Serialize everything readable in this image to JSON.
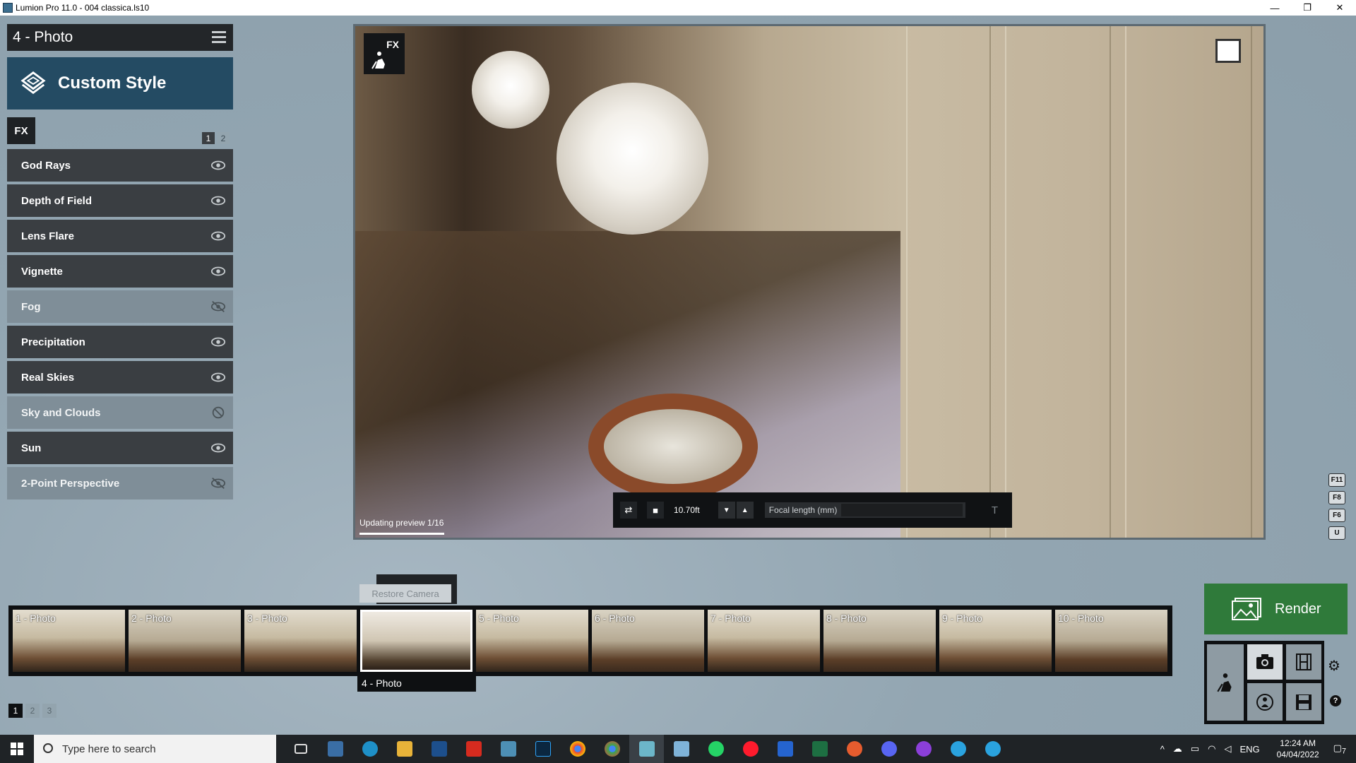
{
  "window": {
    "title": "Lumion Pro 11.0  - 004 classica.ls10",
    "controls": [
      "—",
      "❐",
      "✕"
    ]
  },
  "left_panel": {
    "photo_title": "4 - Photo",
    "style_name": "Custom Style",
    "fx_tab": "FX",
    "fx_pages": [
      "1",
      "2"
    ],
    "effects": [
      {
        "label": "God Rays",
        "visible": true
      },
      {
        "label": "Depth of Field",
        "visible": true
      },
      {
        "label": "Lens Flare",
        "visible": true
      },
      {
        "label": "Vignette",
        "visible": true
      },
      {
        "label": "Fog",
        "visible": false
      },
      {
        "label": "Precipitation",
        "visible": true
      },
      {
        "label": "Real Skies",
        "visible": true
      },
      {
        "label": "Sky and Clouds",
        "visible": false
      },
      {
        "label": "Sun",
        "visible": true
      },
      {
        "label": "2-Point Perspective",
        "visible": false
      }
    ]
  },
  "viewport": {
    "fx_badge": "FX",
    "status": "Updating preview 1/16",
    "camera_height": "10.70ft",
    "focal_label": "Focal length (mm)",
    "t_icon": "T"
  },
  "side_keys": [
    "F11",
    "F8",
    "F6",
    "U"
  ],
  "restore_camera": "Restore Camera",
  "photos": [
    "1 - Photo",
    "2 - Photo",
    "3 - Photo",
    "",
    "5 - Photo",
    "6 - Photo",
    "7 - Photo",
    "8 - Photo",
    "9 - Photo",
    "10 - Photo"
  ],
  "selected_photo_caption": "4 - Photo",
  "photo_pages": [
    "1",
    "2",
    "3"
  ],
  "render": {
    "label": "Render"
  },
  "taskbar": {
    "search_placeholder": "Type here to search",
    "language": "ENG",
    "time": "12:24 AM",
    "date": "04/04/2022",
    "notification_count": "7"
  },
  "colors": {
    "render_green": "#2f7a3a",
    "style_blue": "#244b63",
    "panel_dark": "#3a3e42"
  }
}
